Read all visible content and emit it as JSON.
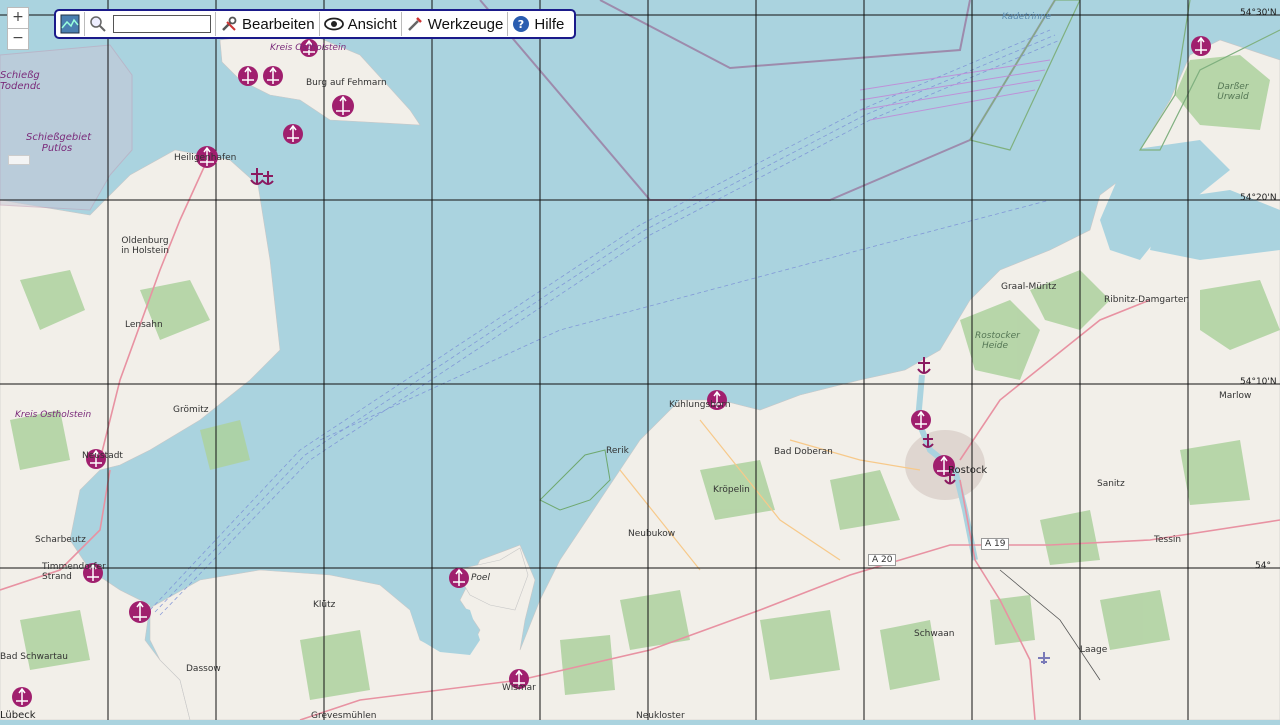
{
  "map": {
    "zoom_in": "+",
    "zoom_out": "−",
    "latitude_labels": [
      "54°30'N",
      "54°20'N",
      "54°10'N",
      "54°"
    ],
    "places": [
      {
        "name": "Burg auf Fehmarn"
      },
      {
        "name": "Heiligenhafen"
      },
      {
        "name": "Oldenburg in Holstein"
      },
      {
        "name": "Lensahn"
      },
      {
        "name": "Grömitz"
      },
      {
        "name": "Neustadt"
      },
      {
        "name": "Scharbeutz"
      },
      {
        "name": "Timmendorfer Strand"
      },
      {
        "name": "Bad Schwartau"
      },
      {
        "name": "Lübeck"
      },
      {
        "name": "Dassow"
      },
      {
        "name": "Klütz"
      },
      {
        "name": "Grevesmühlen"
      },
      {
        "name": "Wismar"
      },
      {
        "name": "Neukloster"
      },
      {
        "name": "Poel"
      },
      {
        "name": "Rerik"
      },
      {
        "name": "Kühlungsborn"
      },
      {
        "name": "Kröpelin"
      },
      {
        "name": "Neubukow"
      },
      {
        "name": "Bad Doberan"
      },
      {
        "name": "Rostock"
      },
      {
        "name": "Schwaan"
      },
      {
        "name": "Laage"
      },
      {
        "name": "Sanitz"
      },
      {
        "name": "Tessin"
      },
      {
        "name": "Marlow"
      },
      {
        "name": "Graal-Müritz"
      },
      {
        "name": "Ribnitz-Damgarten"
      },
      {
        "name": "Darßer Urwald"
      },
      {
        "name": "Rostocker Heide"
      },
      {
        "name": "Kreis Ostholstein"
      },
      {
        "name": "Kreis Ostholstein"
      },
      {
        "name": "Schießgebiet Putlos"
      },
      {
        "name": "Schießgebiet Todendorf"
      },
      {
        "name": "Kadetrinne"
      }
    ],
    "roads": [
      "A 20",
      "A 19"
    ],
    "colors": {
      "water": "#aad3df",
      "land": "#f2efe9",
      "forest": "#add19e",
      "grid": "#111111",
      "marker": "#a01f6e"
    }
  },
  "toolbar": {
    "search_placeholder": "",
    "edit_label": "Bearbeiten",
    "view_label": "Ansicht",
    "tools_label": "Werkzeuge",
    "help_label": "Hilfe"
  }
}
